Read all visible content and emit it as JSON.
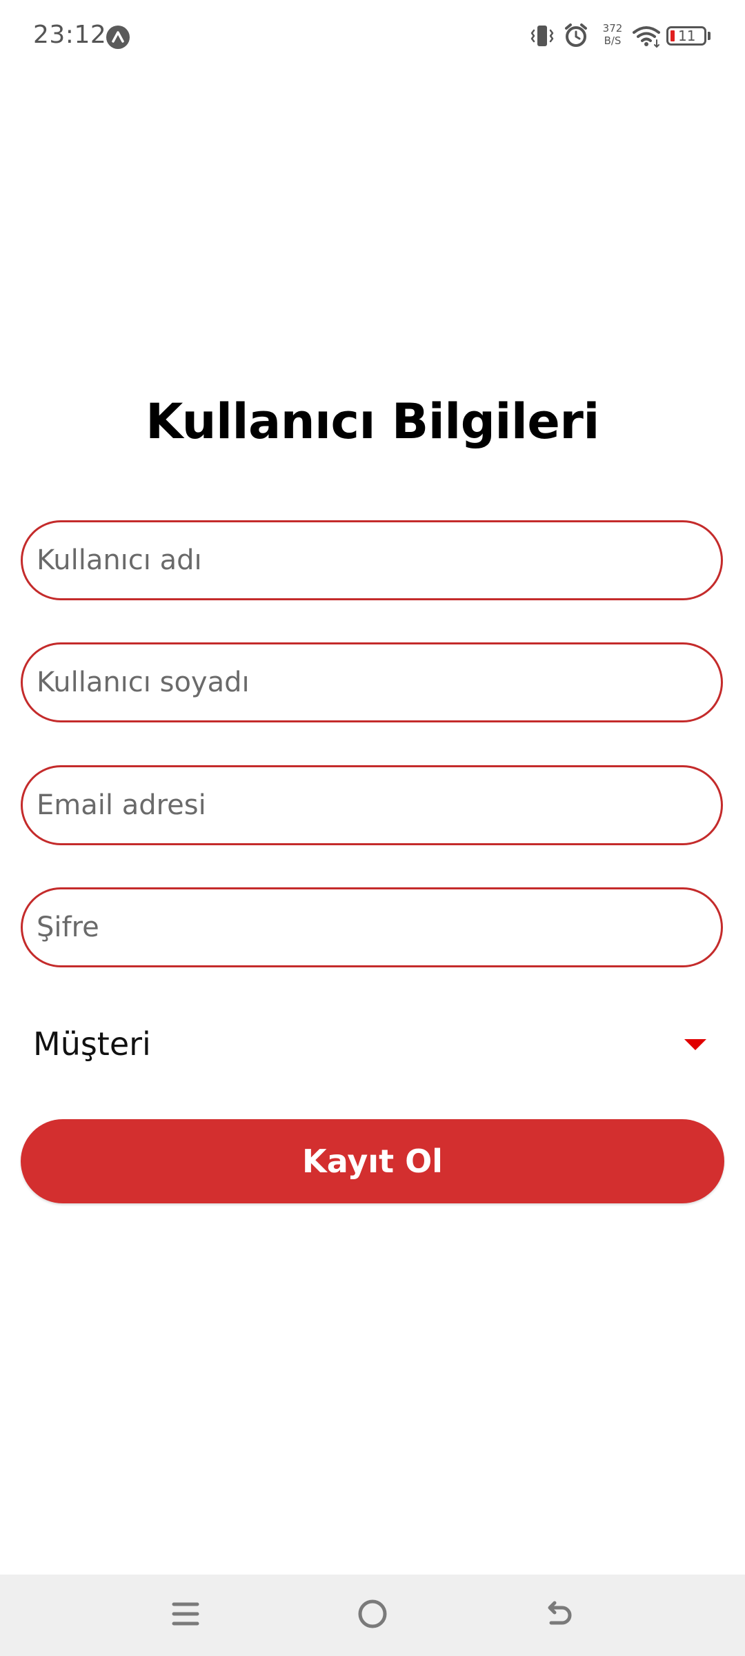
{
  "status_bar": {
    "time": "23:12",
    "net_speed_value": "372",
    "net_speed_unit": "B/S",
    "battery_level": "11"
  },
  "form": {
    "title": "Kullanıcı Bilgileri",
    "fields": [
      {
        "placeholder": "Kullanıcı adı",
        "value": ""
      },
      {
        "placeholder": "Kullanıcı soyadı",
        "value": ""
      },
      {
        "placeholder": "Email adresi",
        "value": ""
      },
      {
        "placeholder": "Şifre",
        "value": ""
      }
    ],
    "role_select": {
      "selected": "Müşteri"
    },
    "submit_label": "Kayıt Ol"
  },
  "colors": {
    "accent": "#d32f2f",
    "field_border": "#c42b2b",
    "dropdown_arrow": "#e00000",
    "battery_low": "#e02020",
    "nav_bar_bg": "#efefef"
  },
  "icons": {
    "status_app": "app-notification-icon",
    "vibrate": "vibrate-icon",
    "alarm": "alarm-icon",
    "wifi": "wifi-icon",
    "battery": "battery-icon",
    "nav_menu": "menu-icon",
    "nav_home": "home-icon",
    "nav_back": "back-icon",
    "dropdown": "caret-down-icon"
  }
}
